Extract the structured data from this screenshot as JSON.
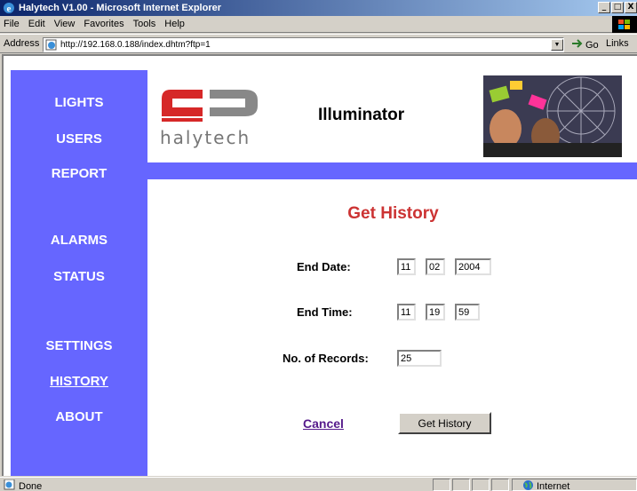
{
  "window": {
    "title": "Halytech V1.00 - Microsoft Internet Explorer",
    "minimize": "_",
    "maximize": "□",
    "close": "X"
  },
  "menu": {
    "items": [
      {
        "label": "File"
      },
      {
        "label": "Edit"
      },
      {
        "label": "View"
      },
      {
        "label": "Favorites"
      },
      {
        "label": "Tools"
      },
      {
        "label": "Help"
      }
    ]
  },
  "addressbar": {
    "label": "Address",
    "url": "http://192.168.0.188/index.dhtm?ftp=1",
    "go_label": "Go",
    "links_label": "Links"
  },
  "nav": {
    "items": [
      {
        "label": "LIGHTS"
      },
      {
        "label": "USERS"
      },
      {
        "label": "REPORT"
      },
      {
        "label": "ALARMS"
      },
      {
        "label": "STATUS"
      },
      {
        "label": "SETTINGS"
      },
      {
        "label": "HISTORY"
      },
      {
        "label": "ABOUT"
      }
    ],
    "active": "HISTORY"
  },
  "header": {
    "brand": "halytech",
    "app_title": "Illuminator"
  },
  "form": {
    "title": "Get History",
    "end_date_label": "End Date:",
    "end_date": {
      "day": "11",
      "month": "02",
      "year": "2004"
    },
    "end_time_label": "End Time:",
    "end_time": {
      "hour": "11",
      "minute": "19",
      "second": "59"
    },
    "records_label": "No. of Records:",
    "records": "25",
    "cancel_label": "Cancel",
    "submit_label": "Get History"
  },
  "status": {
    "text": "Done",
    "zone": "Internet"
  },
  "colors": {
    "nav_bg": "#6666ff",
    "title_red": "#cc3333",
    "logo_red": "#d62828",
    "visited_link": "#551a8b"
  }
}
